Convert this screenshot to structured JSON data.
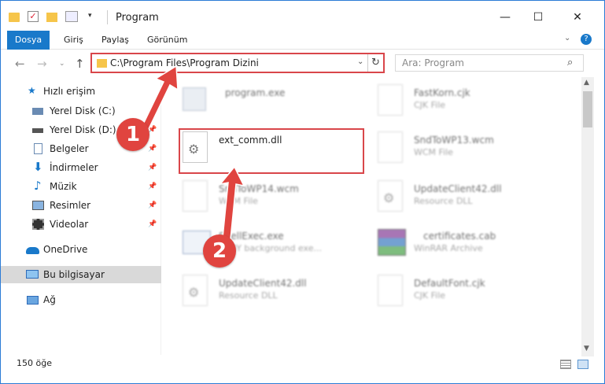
{
  "window": {
    "title": "Program"
  },
  "ribbon": {
    "tabs": [
      "Dosya",
      "Giriş",
      "Paylaş",
      "Görünüm"
    ]
  },
  "address": {
    "path": "C:\\Program Files\\Program Dizini",
    "search_placeholder": "Ara: Program"
  },
  "sidebar": {
    "items": [
      {
        "label": "Hızlı erişim",
        "icon": "star-icon"
      },
      {
        "label": "Yerel Disk (C:)",
        "icon": "disk-icon"
      },
      {
        "label": "Yerel Disk (D:)",
        "icon": "disk-icon"
      },
      {
        "label": "Belgeler",
        "icon": "documents-icon"
      },
      {
        "label": "İndirmeler",
        "icon": "download-icon"
      },
      {
        "label": "Müzik",
        "icon": "music-icon"
      },
      {
        "label": "Resimler",
        "icon": "pictures-icon"
      },
      {
        "label": "Videolar",
        "icon": "videos-icon"
      },
      {
        "label": "OneDrive",
        "icon": "cloud-icon"
      },
      {
        "label": "Bu bilgisayar",
        "icon": "computer-icon"
      },
      {
        "label": "Ağ",
        "icon": "network-icon"
      }
    ]
  },
  "files": [
    {
      "name": "program.exe",
      "type": ""
    },
    {
      "name": "FastKorn.cjk",
      "type": "CJK File"
    },
    {
      "name": "ext_comm.dll",
      "type": ""
    },
    {
      "name": "SndToWP13.wcm",
      "type": "WCM File"
    },
    {
      "name": "SndToWP14.wcm",
      "type": "WCM File"
    },
    {
      "name": "UpdateClient42.dll",
      "type": "Resource DLL"
    },
    {
      "name": "ShellExec.exe",
      "type": "SHBY background exe..."
    },
    {
      "name": "certificates.cab",
      "type": "WinRAR Archive"
    },
    {
      "name": "UpdateClient42.dll",
      "type": "Resource DLL"
    },
    {
      "name": "DefaultFont.cjk",
      "type": "CJK File"
    }
  ],
  "status": {
    "count": "150 öğe"
  },
  "annotations": [
    "1",
    "2"
  ],
  "colors": {
    "accent": "#1979ca",
    "highlight": "#d9464a"
  }
}
